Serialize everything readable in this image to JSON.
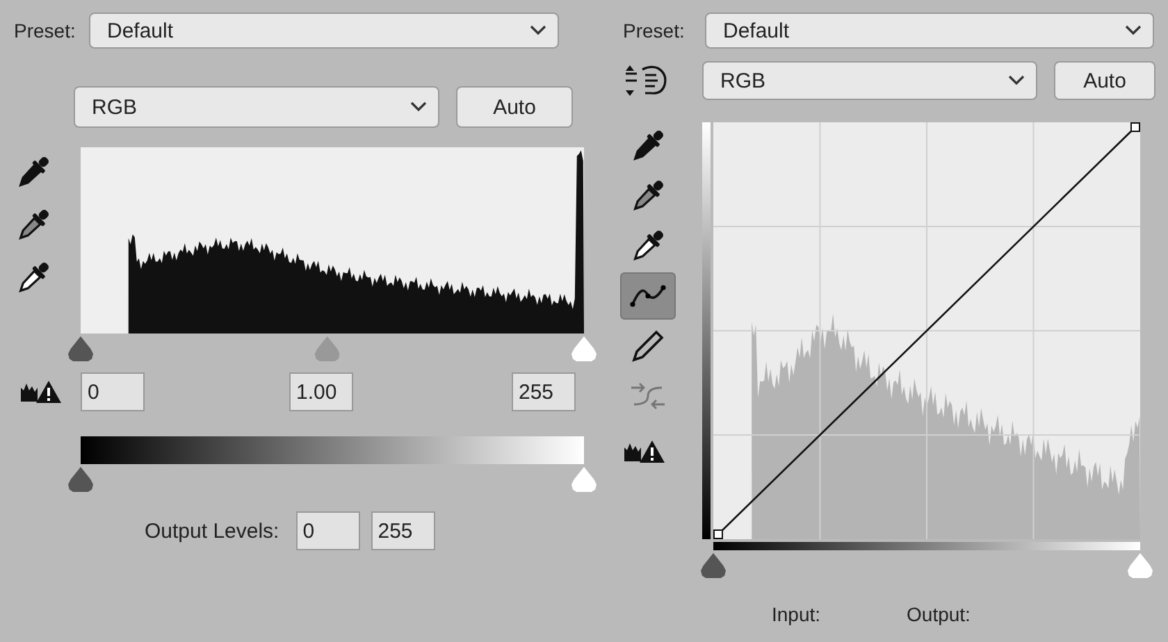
{
  "levels": {
    "preset": {
      "label": "Preset:",
      "value": "Default"
    },
    "channel": "RGB",
    "auto_button": "Auto",
    "input_values": [
      "0",
      "1.00",
      "255"
    ],
    "output_label": "Output Levels:",
    "output_values": [
      "0",
      "255"
    ]
  },
  "curves": {
    "preset": {
      "label": "Preset:",
      "value": "Default"
    },
    "channel": "RGB",
    "auto_button": "Auto",
    "tools": [
      {
        "kind": "black-eyedropper",
        "selected": false,
        "disabled": false
      },
      {
        "kind": "gray-eyedropper",
        "selected": false,
        "disabled": false
      },
      {
        "kind": "white-eyedropper",
        "selected": false,
        "disabled": false
      },
      {
        "kind": "curve",
        "selected": true,
        "disabled": false
      },
      {
        "kind": "pencil",
        "selected": false,
        "disabled": false
      },
      {
        "kind": "smooth",
        "selected": false,
        "disabled": true
      }
    ],
    "input_label": "Input:",
    "output_label": "Output:"
  }
}
